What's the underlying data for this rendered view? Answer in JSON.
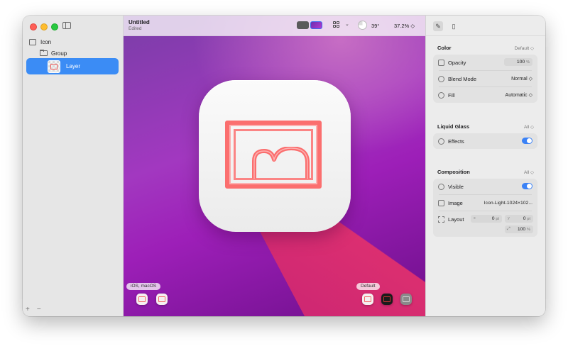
{
  "document": {
    "title": "Untitled",
    "subtitle": "Edited"
  },
  "sidebar": {
    "items": [
      {
        "label": "Icon"
      },
      {
        "label": "Group"
      },
      {
        "label": "Layer"
      }
    ],
    "add_label": "+",
    "remove_label": "−"
  },
  "toolbar": {
    "angle": "39°",
    "zoom": "37.2% ◇",
    "grid_chevron": "⌄"
  },
  "canvas": {
    "platform_label": "iOS, macOS",
    "appearance_label": "Default"
  },
  "inspector": {
    "color": {
      "title": "Color",
      "right": "Default ◇",
      "opacity_label": "Opacity",
      "opacity_value": "100",
      "opacity_unit": "%",
      "blend_label": "Blend Mode",
      "blend_value": "Normal ◇",
      "fill_label": "Fill",
      "fill_value": "Automatic ◇"
    },
    "liquid_glass": {
      "title": "Liquid Glass",
      "right": "All ◇",
      "effects_label": "Effects",
      "effects_on": true
    },
    "composition": {
      "title": "Composition",
      "right": "All ◇",
      "visible_label": "Visible",
      "visible_on": true,
      "image_label": "Image",
      "image_value": "Icon-Light-1024×102...",
      "layout_label": "Layout",
      "x_label": "x",
      "x_value": "0",
      "y_label": "y",
      "y_value": "0",
      "scale_value": "100",
      "unit_pt": "pt",
      "unit_pct": "%"
    }
  },
  "colors": {
    "accent": "#3b8cf5",
    "icon_red": "#fb6f6f"
  }
}
